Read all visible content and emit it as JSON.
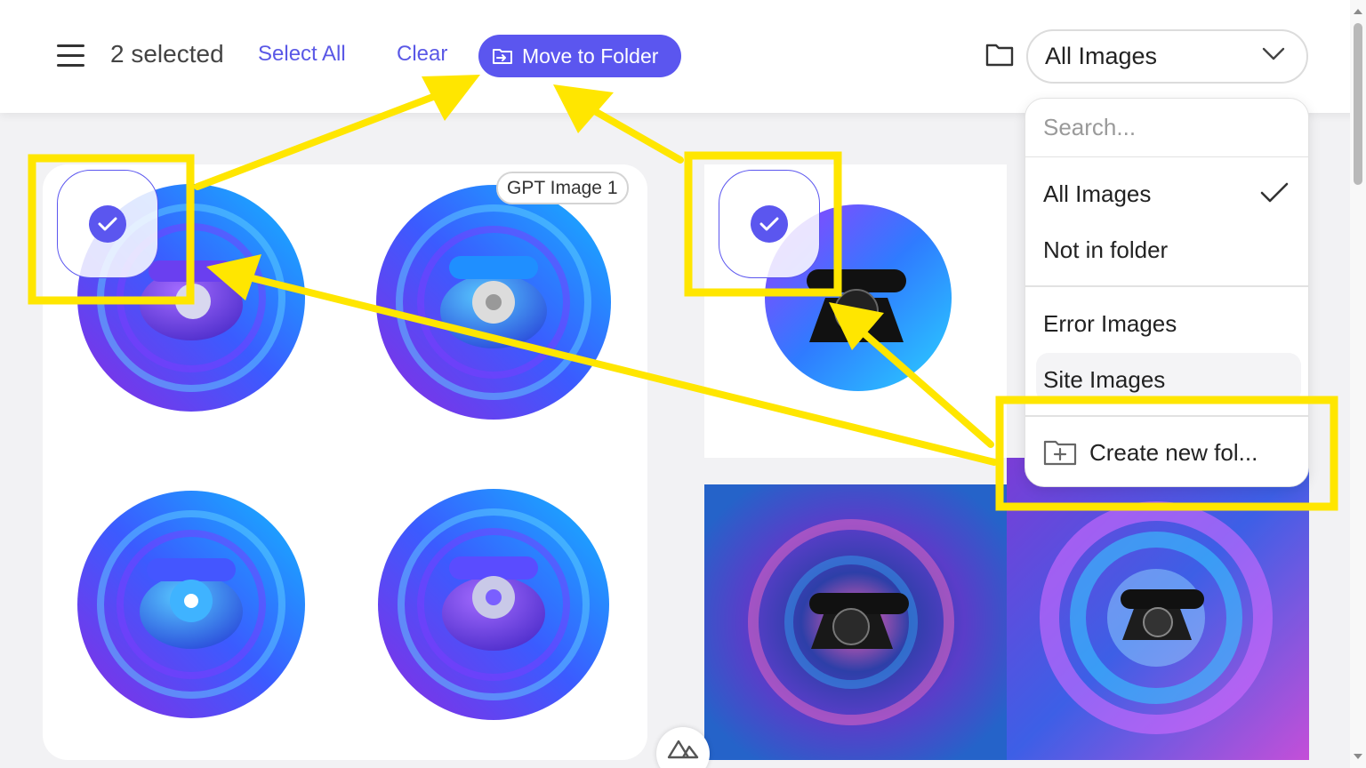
{
  "header": {
    "selected_text": "2 selected",
    "select_all_label": "Select All",
    "clear_label": "Clear",
    "move_to_folder_label": "Move to Folder",
    "folder_filter_value": "All Images"
  },
  "card": {
    "badge": "GPT Image 1"
  },
  "folder_menu": {
    "search_placeholder": "Search...",
    "items": [
      {
        "label": "All Images",
        "checked": true
      },
      {
        "label": "Not in folder",
        "checked": false
      }
    ],
    "folders": [
      {
        "label": "Error Images"
      },
      {
        "label": "Site Images"
      }
    ],
    "create_label": "Create new fol..."
  },
  "colors": {
    "accent": "#5b56ef",
    "annotation": "#ffe600"
  },
  "icons": [
    "hamburger-icon",
    "folder-move-icon",
    "folder-icon",
    "chevron-down-icon",
    "check-icon",
    "folder-plus-icon",
    "nuxt-logo-icon"
  ]
}
